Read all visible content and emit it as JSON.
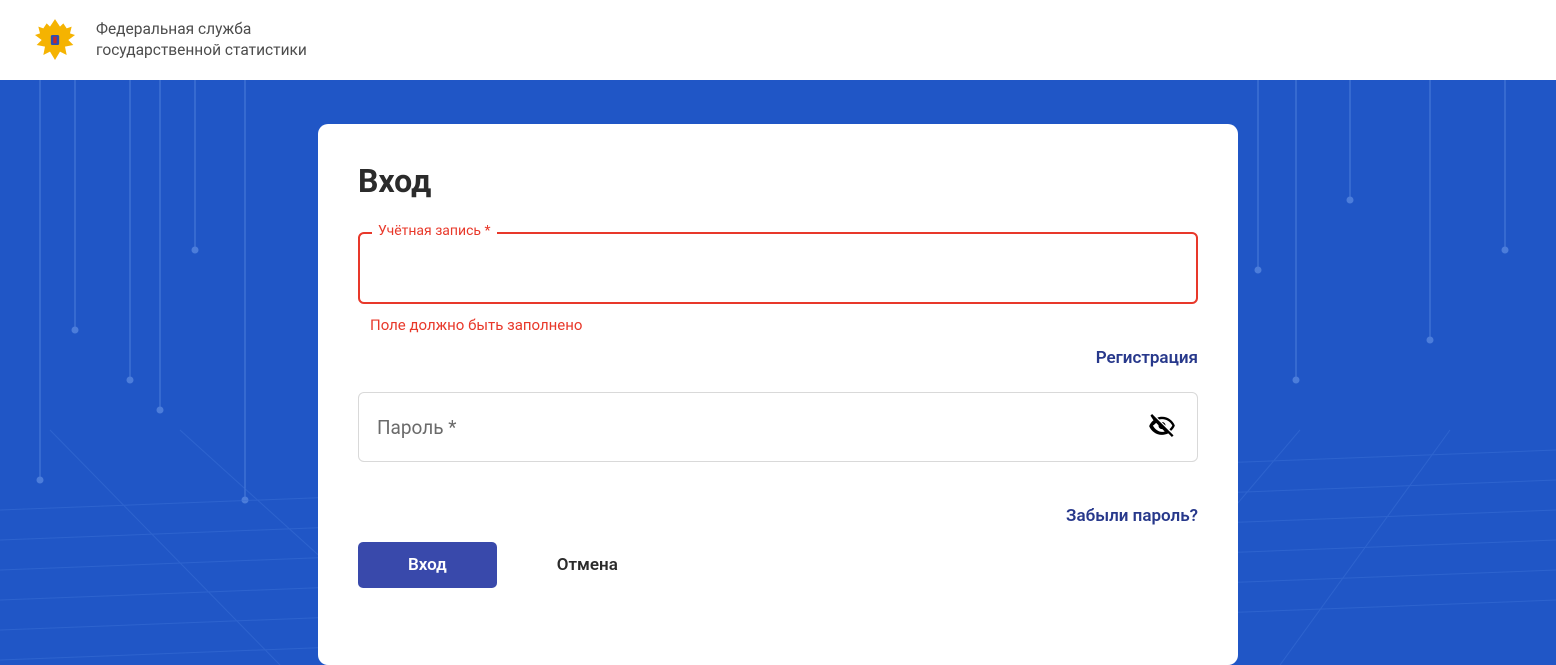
{
  "header": {
    "org_line1": "Федеральная служба",
    "org_line2": "государственной статистики"
  },
  "login": {
    "title": "Вход",
    "account_label": "Учётная запись *",
    "account_value": "",
    "account_error": "Поле должно быть заполнено",
    "register_link": "Регистрация",
    "password_placeholder": "Пароль *",
    "password_value": "",
    "forgot_link": "Забыли пароль?",
    "submit": "Вход",
    "cancel": "Отмена"
  },
  "colors": {
    "bg": "#2056c6",
    "error": "#e8382a",
    "primary_btn": "#3949ab",
    "link": "#27388b"
  }
}
